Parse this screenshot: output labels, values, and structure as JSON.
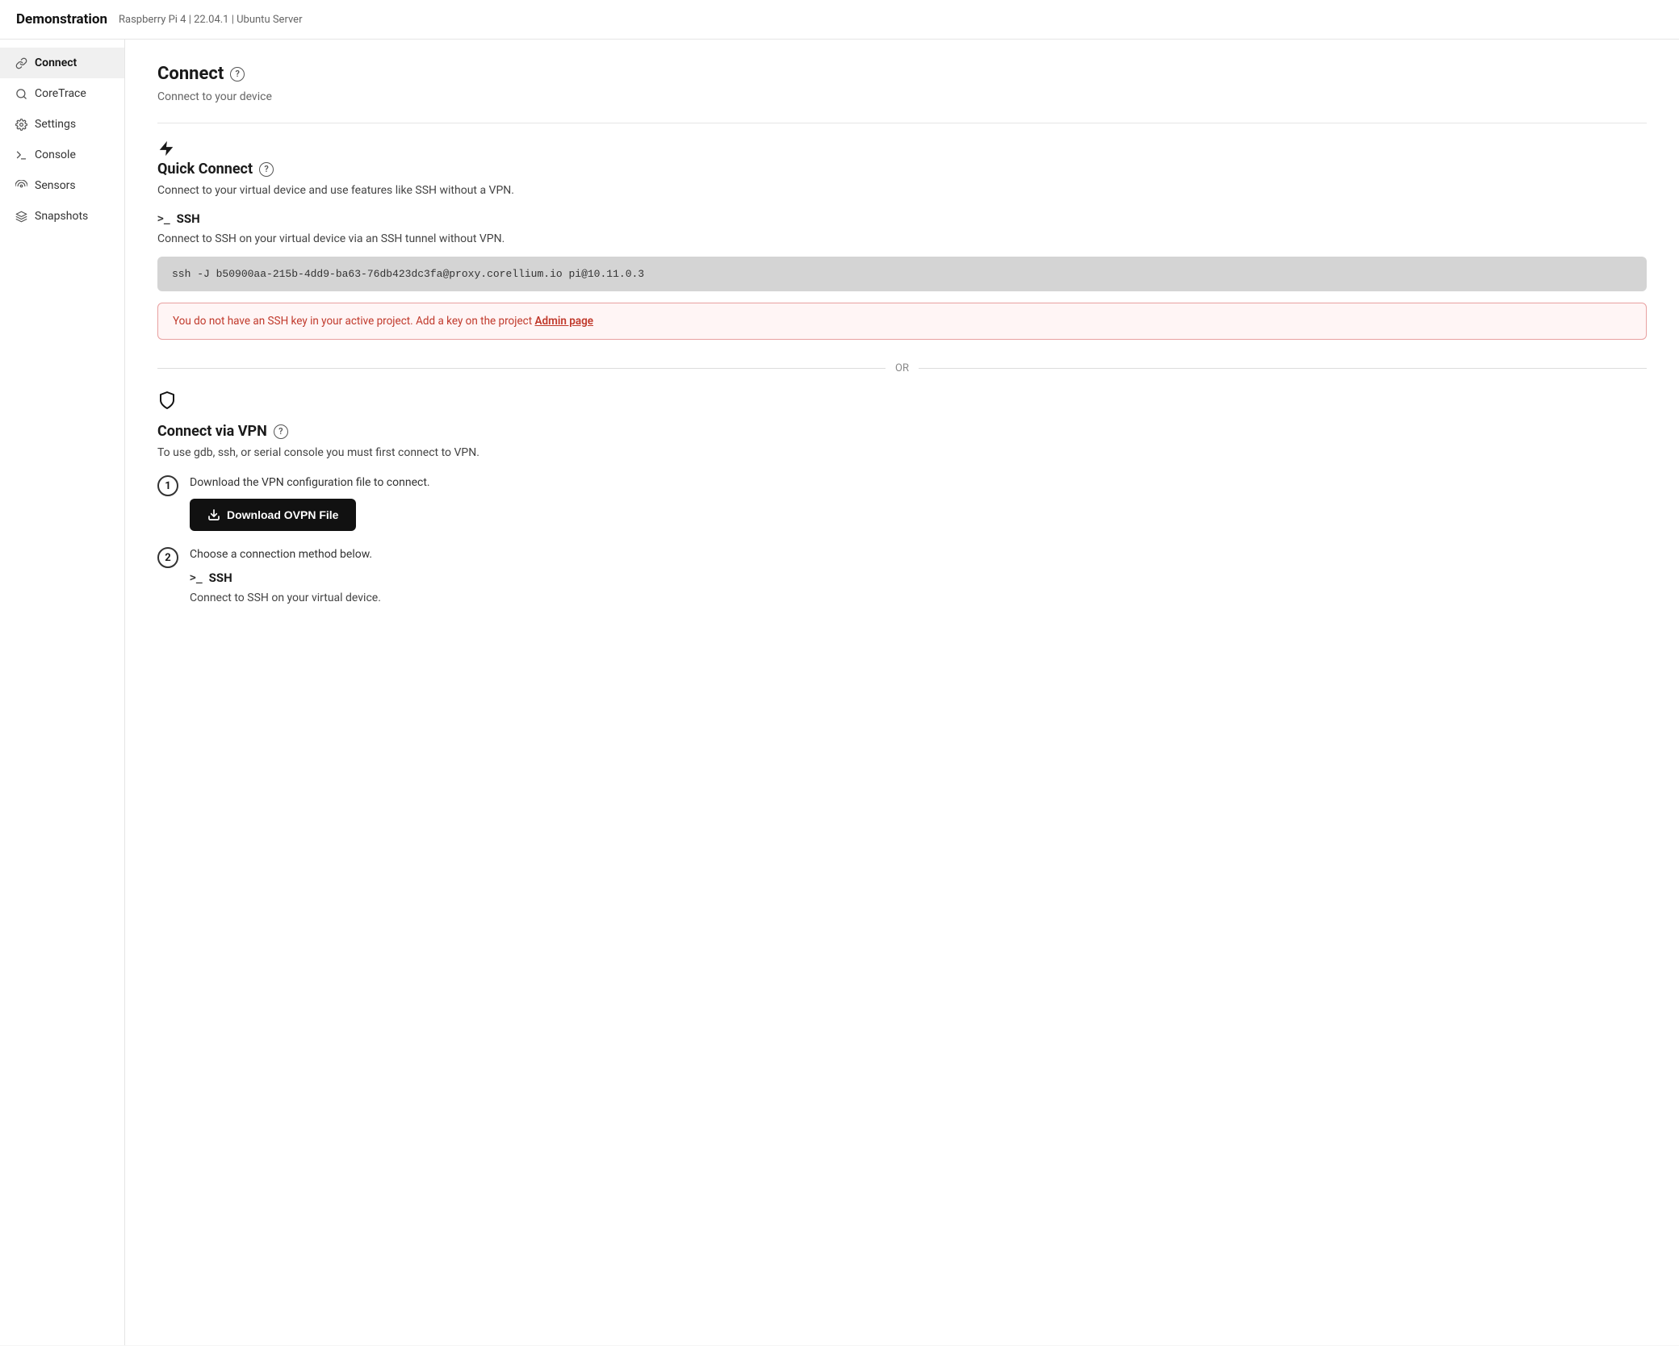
{
  "header": {
    "title": "Demonstration",
    "meta": "Raspberry Pi 4 | 22.04.1 | Ubuntu Server"
  },
  "sidebar": {
    "items": [
      {
        "id": "connect",
        "label": "Connect",
        "icon": "link",
        "active": true
      },
      {
        "id": "coretrace",
        "label": "CoreTrace",
        "icon": "search"
      },
      {
        "id": "settings",
        "label": "Settings",
        "icon": "gear"
      },
      {
        "id": "console",
        "label": "Console",
        "icon": "terminal"
      },
      {
        "id": "sensors",
        "label": "Sensors",
        "icon": "wifi"
      },
      {
        "id": "snapshots",
        "label": "Snapshots",
        "icon": "layers"
      }
    ]
  },
  "main": {
    "page_title": "Connect",
    "page_subtitle": "Connect to your device",
    "quick_connect": {
      "title": "Quick Connect",
      "description": "Connect to your virtual device and use features like SSH without a VPN.",
      "ssh": {
        "title": "SSH",
        "description": "Connect to SSH on your virtual device via an SSH tunnel without VPN.",
        "command": "ssh -J b50900aa-215b-4dd9-ba63-76db423dc3fa@proxy.corellium.io pi@10.11.0.3"
      },
      "warning": {
        "text": "You do not have an SSH key in your active project. Add a key on the project ",
        "link_text": "Admin page"
      }
    },
    "or_divider": "OR",
    "vpn": {
      "title": "Connect via VPN",
      "description": "To use gdb, ssh, or serial console you must first connect to VPN.",
      "steps": [
        {
          "num": "1",
          "label": "Download the VPN configuration file to connect.",
          "button": "Download OVPN File"
        },
        {
          "num": "2",
          "label": "Choose a connection method below.",
          "sub_ssh_title": "SSH",
          "sub_ssh_desc": "Connect to SSH on your virtual device."
        }
      ]
    }
  }
}
